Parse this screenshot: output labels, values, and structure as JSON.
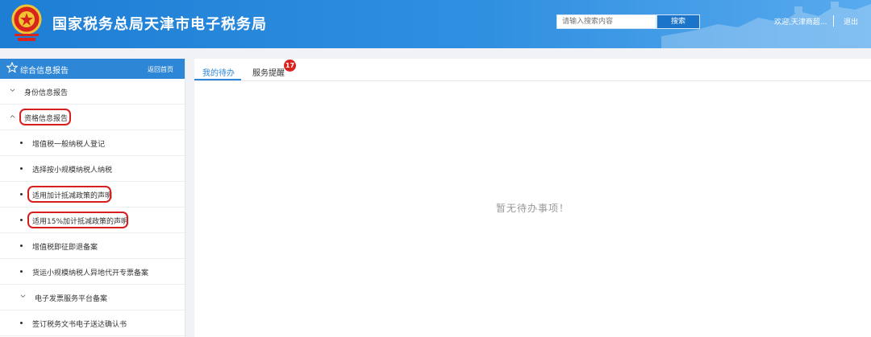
{
  "header": {
    "title": "国家税务总局天津市电子税务局",
    "search_placeholder": "请输入搜索内容",
    "search_button": "搜索",
    "welcome": "欢迎,天津商超...",
    "logout": "退出",
    "colors": {
      "bar_start": "#1e7ed4",
      "bar_end": "#58aaee"
    }
  },
  "sidebar": {
    "title": "综合信息报告",
    "back_label": "返回首页",
    "items": [
      {
        "label": "身份信息报告",
        "kind": "group",
        "state": "collapsed"
      },
      {
        "label": "资格信息报告",
        "kind": "group",
        "state": "expanded",
        "circled": true
      },
      {
        "label": "增值税一般纳税人登记",
        "kind": "leaf"
      },
      {
        "label": "选择按小规模纳税人纳税",
        "kind": "leaf"
      },
      {
        "label": "适用加计抵减政策的声明",
        "kind": "leaf",
        "circled": true
      },
      {
        "label": "适用15%加计抵减政策的声明",
        "kind": "leaf",
        "circled": true
      },
      {
        "label": "增值税即征即退备案",
        "kind": "leaf"
      },
      {
        "label": "货运小规模纳税人异地代开专票备案",
        "kind": "leaf"
      },
      {
        "label": "电子发票服务平台备案",
        "kind": "subgroup",
        "state": "collapsed"
      },
      {
        "label": "签订税务文书电子送达确认书",
        "kind": "leaf"
      }
    ],
    "accent": "#2e86d6",
    "highlight_color": "#d91e1e"
  },
  "main": {
    "tabs": [
      {
        "label": "我的待办",
        "active": true
      },
      {
        "label": "服务提醒",
        "active": false,
        "badge": "17"
      }
    ],
    "empty_message": "暂无待办事项！"
  }
}
